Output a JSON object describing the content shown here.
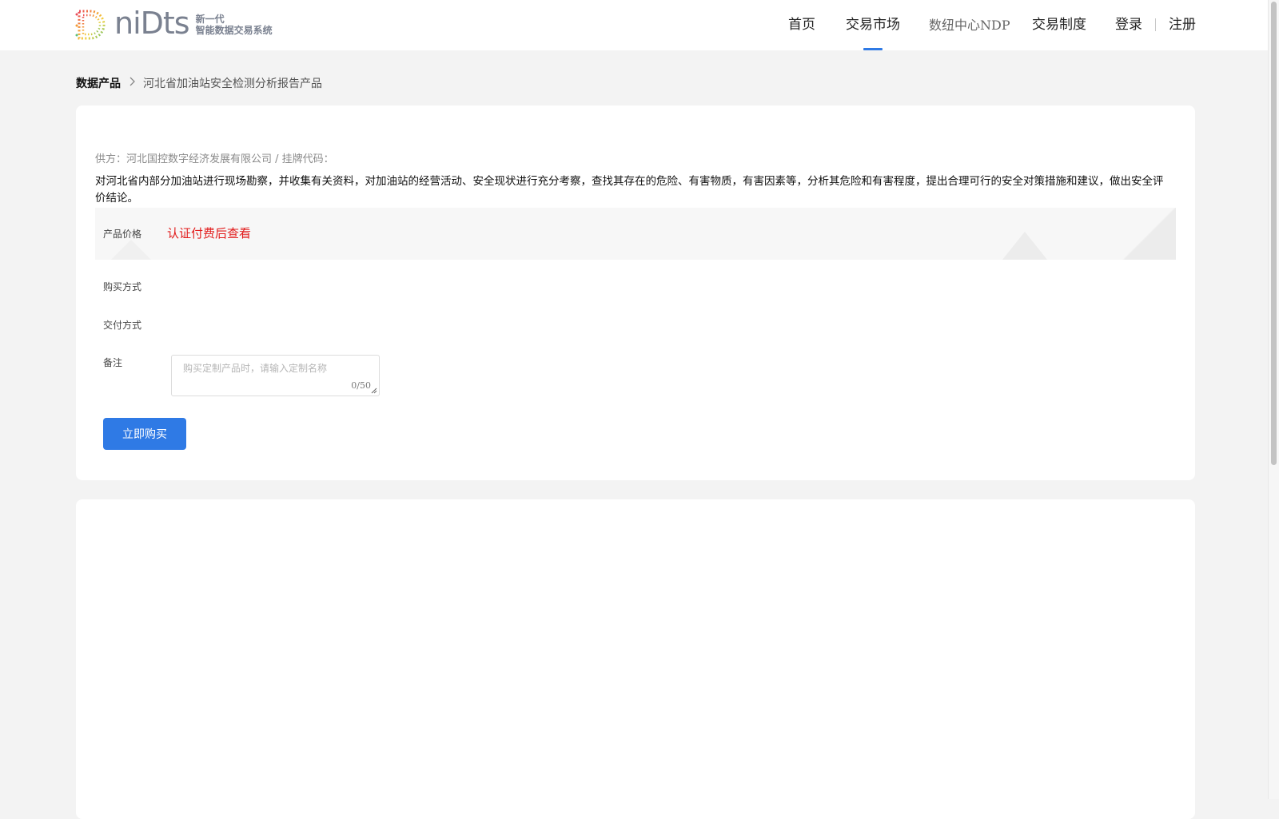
{
  "header": {
    "logo": {
      "wordmark": "niDts",
      "subtitle_line1": "新一代",
      "subtitle_line2": "智能数据交易系统"
    },
    "nav": [
      {
        "label": "首页",
        "active": false
      },
      {
        "label": "交易市场",
        "active": true
      },
      {
        "label": "数纽中心NDP",
        "active": false
      },
      {
        "label": "交易制度",
        "active": false
      }
    ],
    "login_label": "登录",
    "register_label": "注册",
    "accent_color": "#2f7ae5"
  },
  "breadcrumb": {
    "root": "数据产品",
    "separator_icon": "chevron-right-icon",
    "current": "河北省加油站安全检测分析报告产品"
  },
  "product": {
    "supplier_line": "供方：河北国控数字经济发展有限公司 / 挂牌代码：",
    "description": "对河北省内部分加油站进行现场勘察，并收集有关资料，对加油站的经营活动、安全现状进行充分考察，查找其存在的危险、有害物质，有害因素等，分析其危险和有害程度，提出合理可行的安全对策措施和建议，做出安全评价结论。",
    "price_label": "产品价格",
    "price_value": "认证付费后查看",
    "price_color": "#e21b1b",
    "purchase_method_label": "购买方式",
    "delivery_method_label": "交付方式",
    "remark_label": "备注",
    "remark_placeholder": "购买定制产品时，请输入定制名称",
    "remark_value": "",
    "remark_counter": "0/50",
    "buy_button_label": "立即购买"
  }
}
